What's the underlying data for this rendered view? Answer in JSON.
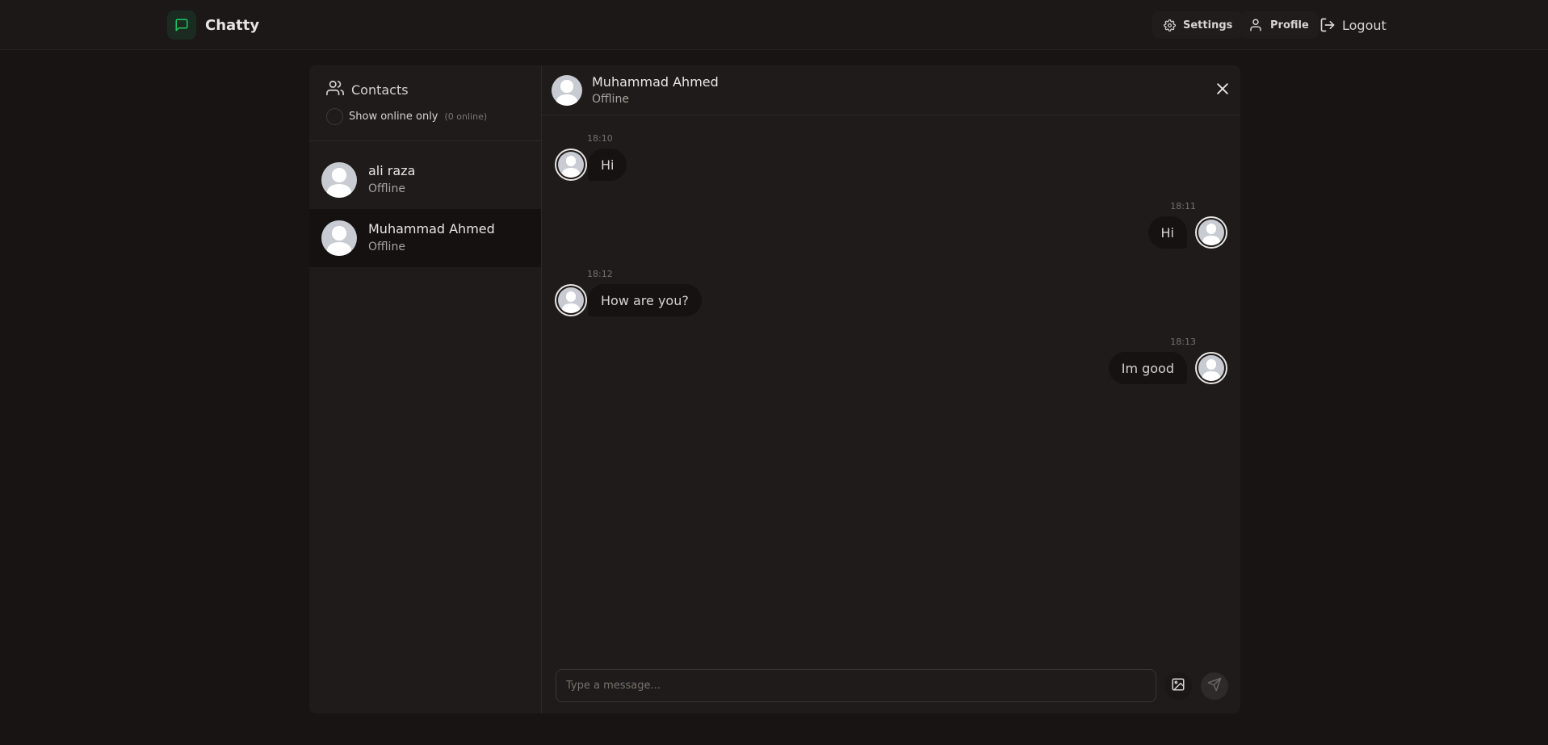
{
  "app": {
    "name": "Chatty",
    "brand_color": "#22c55e"
  },
  "nav": {
    "settings_label": "Settings",
    "profile_label": "Profile",
    "logout_label": "Logout"
  },
  "sidebar": {
    "title": "Contacts",
    "online_toggle_label": "Show online only",
    "online_count": "(0 online)",
    "online_toggle_checked": false,
    "contacts": [
      {
        "name": "ali raza",
        "status": "Offline",
        "selected": false
      },
      {
        "name": "Muhammad Ahmed",
        "status": "Offline",
        "selected": true
      }
    ]
  },
  "chat": {
    "contact_name": "Muhammad Ahmed",
    "contact_status": "Offline",
    "messages": [
      {
        "time": "18:10",
        "text": "Hi",
        "from": "contact"
      },
      {
        "time": "18:11",
        "text": "Hi",
        "from": "me"
      },
      {
        "time": "18:12",
        "text": "How are you?",
        "from": "contact"
      },
      {
        "time": "18:13",
        "text": "Im good",
        "from": "me"
      }
    ],
    "input_placeholder": "Type a message...",
    "input_value": ""
  },
  "icons": {
    "brand": "message-square-icon",
    "settings": "gear-icon",
    "profile": "user-icon",
    "logout": "logout-icon",
    "contacts": "users-icon",
    "close": "close-icon",
    "image": "image-icon",
    "send": "send-icon"
  }
}
